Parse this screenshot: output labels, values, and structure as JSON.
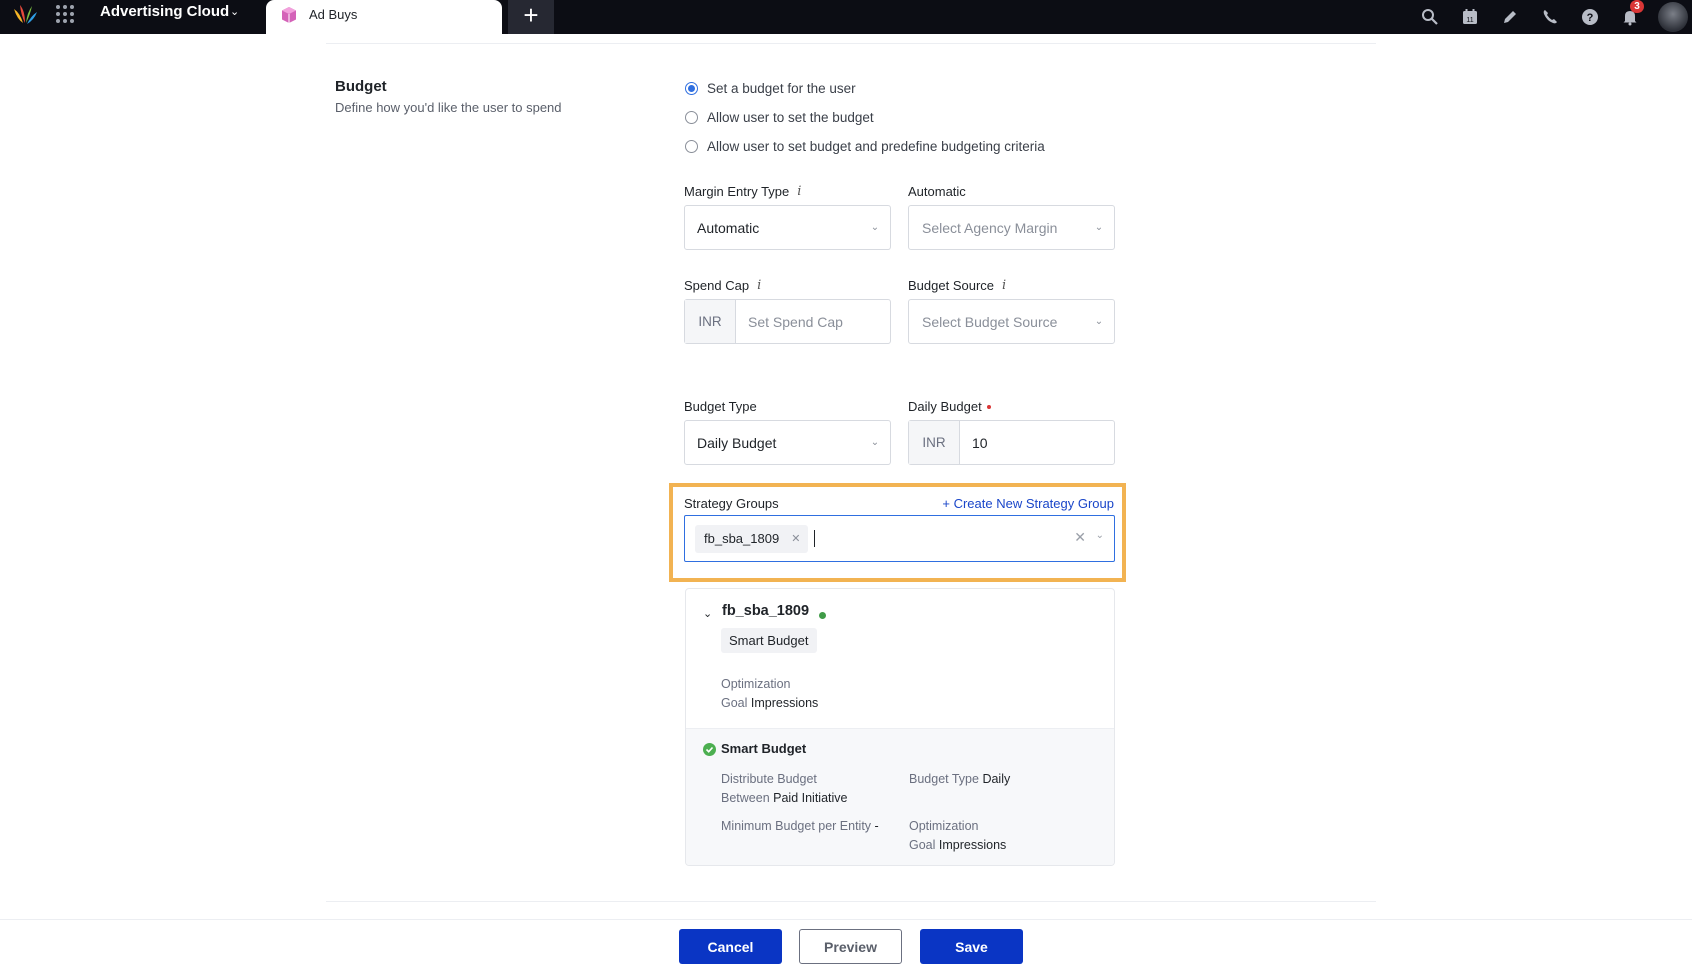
{
  "topbar": {
    "app_title": "Advertising Cloud",
    "tab_label": "Ad Buys",
    "new_tab_label": "+",
    "notification_count": "3",
    "icons": [
      "search-icon",
      "calendar-icon",
      "pencil-icon",
      "phone-icon",
      "help-icon",
      "bell-icon"
    ],
    "calendar_day": "11"
  },
  "budget": {
    "title": "Budget",
    "description": "Define how you'd like the user to spend",
    "options": [
      {
        "label": "Set a budget for the user",
        "selected": true
      },
      {
        "label": "Allow user to set the budget",
        "selected": false
      },
      {
        "label": "Allow user to set budget and predefine budgeting criteria",
        "selected": false
      }
    ]
  },
  "fields": {
    "margin_entry_type": {
      "label": "Margin Entry Type",
      "info": "i",
      "value": "Automatic"
    },
    "agency_margin": {
      "label": "Automatic",
      "placeholder": "Select Agency Margin"
    },
    "spend_cap": {
      "label": "Spend Cap",
      "info": "i",
      "prefix": "INR",
      "placeholder": "Set Spend Cap"
    },
    "budget_source": {
      "label": "Budget Source",
      "info": "i",
      "placeholder": "Select Budget Source"
    },
    "budget_type": {
      "label": "Budget Type",
      "value": "Daily Budget"
    },
    "daily_budget": {
      "label": "Daily Budget",
      "prefix": "INR",
      "value": "10"
    }
  },
  "strategy_groups": {
    "label": "Strategy Groups",
    "create_link": "+ Create New Strategy Group",
    "selected_chip": "fb_sba_1809",
    "highlight_color": "#f2b352",
    "card": {
      "name": "fb_sba_1809",
      "status_color": "#3f9b47",
      "tag": "Smart Budget",
      "optimization_key_1": "Optimization",
      "optimization_key_2": "Goal",
      "optimization_value": "Impressions",
      "smart_budget": {
        "title": "Smart Budget",
        "distribute_key_1": "Distribute Budget",
        "distribute_key_2": "Between",
        "distribute_value": "Paid Initiative",
        "budget_type_key": "Budget Type",
        "budget_type_value": "Daily",
        "min_budget_key": "Minimum Budget per Entity",
        "min_budget_value": "-",
        "opt_key_1": "Optimization",
        "opt_key_2": "Goal",
        "opt_value": "Impressions"
      }
    }
  },
  "actions": {
    "cancel": "Cancel",
    "preview": "Preview",
    "save": "Save",
    "primary_color": "#0a35c4"
  }
}
